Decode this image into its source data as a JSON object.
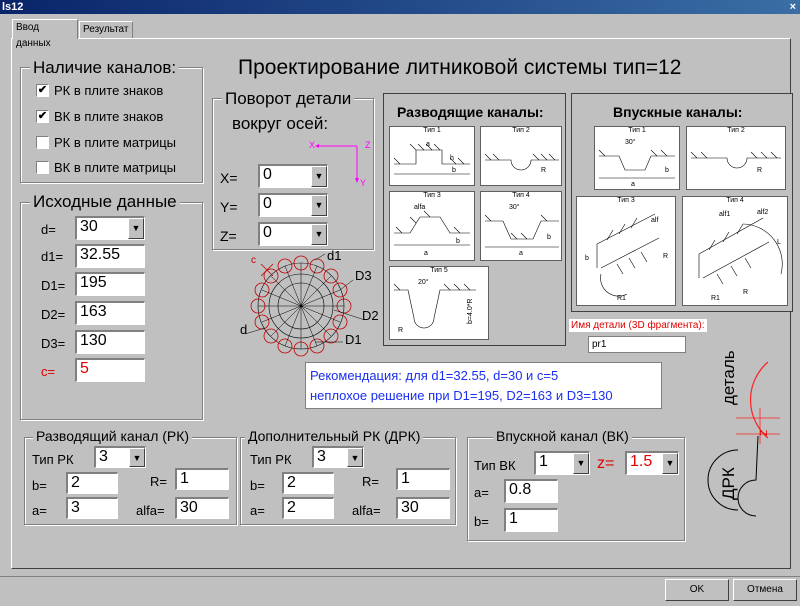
{
  "window": {
    "title": "ls12",
    "close": "×"
  },
  "tabs": [
    "Ввод данных",
    "Результат"
  ],
  "main_title": "Проектирование литниковой системы тип=12",
  "channels": {
    "legend": "Наличие каналов:",
    "items": [
      {
        "label": "РК в плите знаков",
        "checked": true
      },
      {
        "label": "ВК в плите знаков",
        "checked": true
      },
      {
        "label": "РК в плите матрицы",
        "checked": false
      },
      {
        "label": "ВК в плите матрицы",
        "checked": false
      }
    ]
  },
  "rotation": {
    "legend_line1": "Поворот детали",
    "legend_line2": "вокруг осей:",
    "axis_x": "X",
    "axis_y": "Y",
    "axis_z": "Z",
    "fields": [
      {
        "label": "X=",
        "value": "0"
      },
      {
        "label": "Y=",
        "value": "0"
      },
      {
        "label": "Z=",
        "value": "0"
      }
    ]
  },
  "source": {
    "legend": "Исходные данные",
    "d_label": "d=",
    "d_value": "30",
    "fields": [
      {
        "label": "d1=",
        "value": "32.55"
      },
      {
        "label": "D1=",
        "value": "195"
      },
      {
        "label": "D2=",
        "value": "163"
      },
      {
        "label": "D3=",
        "value": "130"
      }
    ],
    "c_label": "c=",
    "c_value": "5"
  },
  "diagram": {
    "d1": "d1",
    "D3": "D3",
    "D2": "D2",
    "D1": "D1",
    "d": "d",
    "c": "c"
  },
  "runner_channels": {
    "title": "Разводящие каналы:",
    "types": [
      {
        "label": "Тип 1",
        "dims": [
          "a",
          "h",
          "b"
        ]
      },
      {
        "label": "Тип 2",
        "dims": [
          "R"
        ]
      },
      {
        "label": "Тип 3",
        "dims": [
          "alfa",
          "a",
          "b"
        ]
      },
      {
        "label": "Тип 4",
        "dims": [
          "30°",
          "a",
          "b"
        ]
      },
      {
        "label": "Тип 5",
        "dims": [
          "20°",
          "b=4.0*R",
          "R"
        ]
      }
    ]
  },
  "gate_channels": {
    "title": "Впускные каналы:",
    "types": [
      {
        "label": "Тип 1",
        "dims": [
          "30°",
          "a",
          "b"
        ]
      },
      {
        "label": "Тип 2",
        "dims": [
          "R"
        ]
      },
      {
        "label": "Тип 3",
        "dims": [
          "alf",
          "R",
          "b",
          "R1"
        ]
      },
      {
        "label": "Тип 4",
        "dims": [
          "alf1",
          "alf2",
          "R",
          "R1",
          "L"
        ]
      }
    ]
  },
  "part_name": {
    "label": "Имя детали (3D фрагмента):",
    "value": "pr1"
  },
  "recommendation": {
    "line1": "Рекомендация: для d1=32.55, d=30 и c=5",
    "line2": "неплохое решение при D1=195, D2=163 и D3=130"
  },
  "side_labels": {
    "detail": "деталь",
    "z": "Z",
    "drk": "ДРК"
  },
  "rk": {
    "legend": "Разводящий канал (РК)",
    "type_label": "Тип РК",
    "type_value": "3",
    "b_label": "b=",
    "b_value": "2",
    "a_label": "a=",
    "a_value": "3",
    "r_label": "R=",
    "r_value": "1",
    "alfa_label": "alfa=",
    "alfa_value": "30"
  },
  "drk": {
    "legend": "Дополнительный РК (ДРК)",
    "type_label": "Тип РК",
    "type_value": "3",
    "b_label": "b=",
    "b_value": "2",
    "a_label": "a=",
    "a_value": "2",
    "r_label": "R=",
    "r_value": "1",
    "alfa_label": "alfa=",
    "alfa_value": "30"
  },
  "vk": {
    "legend": "Впускной канал (ВК)",
    "type_label": "Тип ВК",
    "type_value": "1",
    "z_label": "z=",
    "z_value": "1.5",
    "a_label": "a=",
    "a_value": "0.8",
    "b_label": "b=",
    "b_value": "1"
  },
  "buttons": {
    "ok": "OK",
    "cancel": "Отмена"
  },
  "colors": {
    "accent_red": "#e00000",
    "recommend_blue": "#1a2ef0",
    "magenta": "#ff00ff",
    "titlebar": "#0a246a"
  }
}
